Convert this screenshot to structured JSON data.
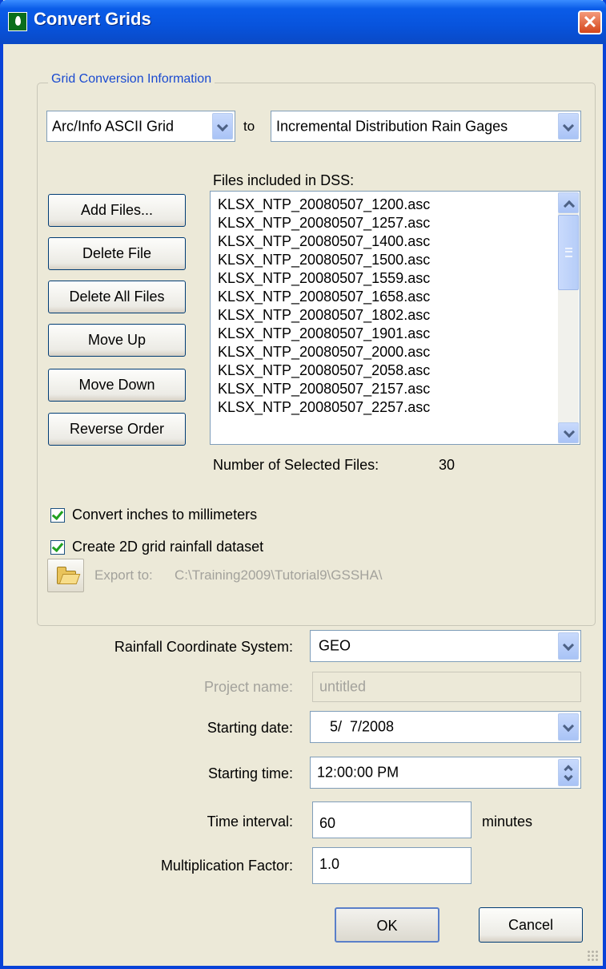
{
  "window": {
    "title": "Convert Grids",
    "close_glyph": "✕"
  },
  "group": {
    "legend": "Grid Conversion Information"
  },
  "conversion": {
    "from_value": "Arc/Info ASCII Grid",
    "to_label": "to",
    "to_value": "Incremental Distribution Rain Gages"
  },
  "buttons": {
    "add_files": "Add Files...",
    "delete_file": "Delete File",
    "delete_all_files": "Delete All Files",
    "move_up": "Move Up",
    "move_down": "Move Down",
    "reverse_order": "Reverse Order",
    "ok": "OK",
    "cancel": "Cancel"
  },
  "files": {
    "label": "Files included in DSS:",
    "items": [
      "KLSX_NTP_20080507_1200.asc",
      "KLSX_NTP_20080507_1257.asc",
      "KLSX_NTP_20080507_1400.asc",
      "KLSX_NTP_20080507_1500.asc",
      "KLSX_NTP_20080507_1559.asc",
      "KLSX_NTP_20080507_1658.asc",
      "KLSX_NTP_20080507_1802.asc",
      "KLSX_NTP_20080507_1901.asc",
      "KLSX_NTP_20080507_2000.asc",
      "KLSX_NTP_20080507_2058.asc",
      "KLSX_NTP_20080507_2157.asc",
      "KLSX_NTP_20080507_2257.asc"
    ],
    "selected_label": "Number of Selected Files:",
    "selected_count": "30"
  },
  "options": {
    "convert_inches": {
      "label": "Convert inches to millimeters",
      "checked": true
    },
    "create_2d": {
      "label": "Create 2D grid rainfall dataset",
      "checked": true
    }
  },
  "export": {
    "label": "Export to:",
    "path": "C:\\Training2009\\Tutorial9\\GSSHA\\",
    "icon": "open-folder-icon"
  },
  "fields": {
    "coord_system": {
      "label": "Rainfall Coordinate System:",
      "value": "GEO"
    },
    "project_name": {
      "label": "Project name:",
      "value": "untitled"
    },
    "starting_date": {
      "label": "Starting date:",
      "value": "5/  7/2008"
    },
    "starting_time": {
      "label": "Starting time:",
      "value": "12:00:00 PM"
    },
    "time_interval": {
      "label": "Time interval:",
      "value": "60",
      "unit": "minutes"
    },
    "multiplication_factor": {
      "label": "Multiplication Factor:",
      "value": "1.0"
    }
  },
  "colors": {
    "titlebar": "#0a5ce8",
    "dialog_bg": "#ECE9D8",
    "legend_text": "#1a4ad0",
    "check_mark": "#21a121",
    "close_button": "#d4461b"
  }
}
